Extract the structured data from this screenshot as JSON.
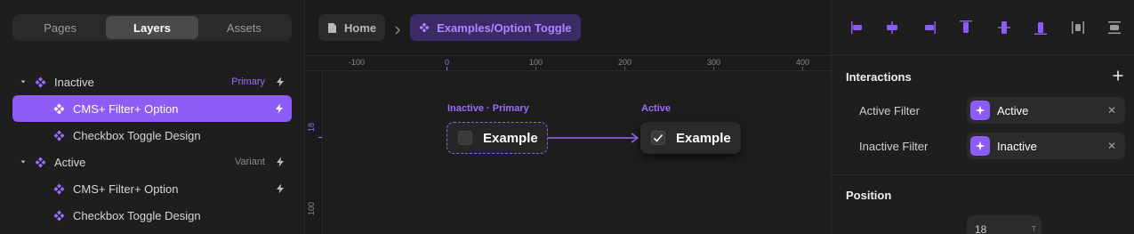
{
  "left_panel": {
    "tabs": [
      {
        "label": "Pages",
        "active": false
      },
      {
        "label": "Layers",
        "active": true
      },
      {
        "label": "Assets",
        "active": false
      }
    ],
    "layers": [
      {
        "label": "Inactive",
        "tag": "Primary",
        "tag_color": "#9c6cff",
        "expanded": true,
        "depth": 0,
        "selected": false
      },
      {
        "label": "CMS+ Filter+ Option",
        "tag": "",
        "depth": 1,
        "selected": true
      },
      {
        "label": "Checkbox Toggle Design",
        "tag": "",
        "depth": 1,
        "selected": false
      },
      {
        "label": "Active",
        "tag": "Variant",
        "tag_color": "#8a8a8a",
        "expanded": true,
        "depth": 0,
        "selected": false
      },
      {
        "label": "CMS+ Filter+ Option",
        "tag": "",
        "depth": 1,
        "selected": false
      },
      {
        "label": "Checkbox Toggle Design",
        "tag": "",
        "depth": 1,
        "selected": false
      }
    ]
  },
  "canvas": {
    "breadcrumb": {
      "home": "Home",
      "component": "Examples/Option Toggle"
    },
    "ruler_x": [
      "-100",
      "0",
      "100",
      "200",
      "300",
      "400"
    ],
    "ruler_y": [
      "18",
      "100"
    ],
    "frames": [
      {
        "label": "Inactive · Primary",
        "text": "Example",
        "checked": false
      },
      {
        "label": "Active",
        "text": "Example",
        "checked": true
      }
    ]
  },
  "right_panel": {
    "interactions": {
      "title": "Interactions",
      "items": [
        {
          "label": "Active Filter",
          "value": "Active"
        },
        {
          "label": "Inactive Filter",
          "value": "Inactive"
        }
      ]
    },
    "position": {
      "title": "Position",
      "value": "18",
      "unit": "T"
    }
  },
  "colors": {
    "accent": "#8d5cf6",
    "accent_text": "#ab86ff",
    "panel_bg": "#1e1e1e",
    "canvas_bg": "#1b1b1b"
  }
}
